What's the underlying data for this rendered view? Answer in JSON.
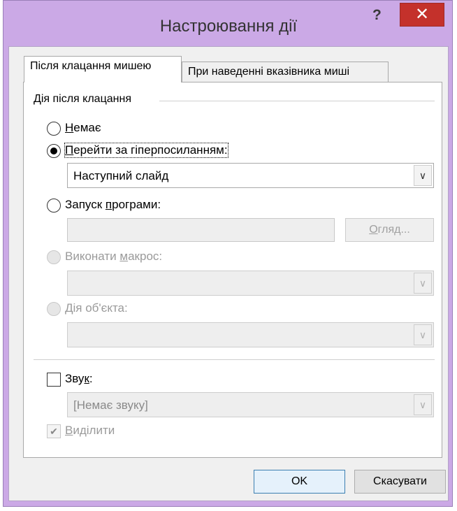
{
  "window": {
    "title": "Настроювання дії",
    "help_label": "?",
    "close_label": "✕"
  },
  "tabs": [
    {
      "label": "Після клацання мишею",
      "active": true
    },
    {
      "label": "При наведенні вказівника миші",
      "active": false
    }
  ],
  "group": {
    "label": "Дія після клацання",
    "options": {
      "none": {
        "u": "Н",
        "rest": "емає"
      },
      "hyperlink": {
        "u": "П",
        "rest": "ерейти за гіперпосиланням:"
      },
      "run_program": {
        "pre": "Запуск ",
        "u": "п",
        "rest": "рограми:"
      },
      "run_macro": {
        "pre": "Виконати ",
        "u": "м",
        "rest": "акрос:"
      },
      "object_action": {
        "u": "Д",
        "rest": "ія об'єкта:"
      }
    },
    "hyperlink_value": "Наступний слайд",
    "program_path": "",
    "browse": {
      "u": "О",
      "rest": "гляд..."
    },
    "macro_value": "",
    "object_value": ""
  },
  "sound": {
    "pre": "Зву",
    "u": "к",
    "rest": ":",
    "value": "[Немає звуку]"
  },
  "highlight": {
    "u": "В",
    "rest": "иділити"
  },
  "buttons": {
    "ok": "OK",
    "cancel": "Скасувати"
  },
  "icons": {
    "dropdown": "chevron-down-icon",
    "check": "checkmark-icon"
  }
}
